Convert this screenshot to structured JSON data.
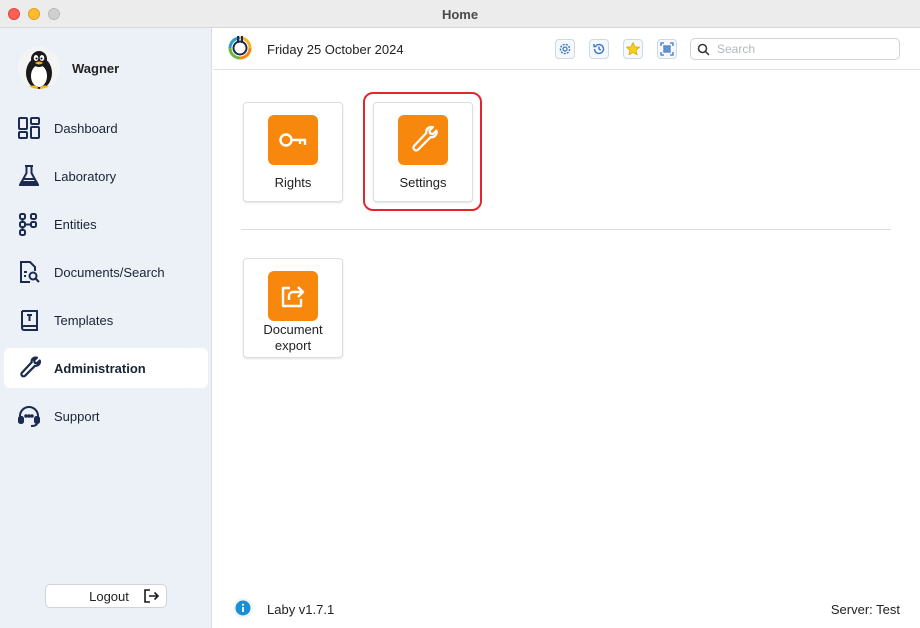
{
  "window": {
    "title": "Home"
  },
  "user": {
    "name": "Wagner"
  },
  "sidebar": {
    "items": [
      {
        "label": "Dashboard",
        "icon": "dashboard-icon",
        "active": false
      },
      {
        "label": "Laboratory",
        "icon": "flask-icon",
        "active": false
      },
      {
        "label": "Entities",
        "icon": "entities-icon",
        "active": false
      },
      {
        "label": "Documents/Search",
        "icon": "document-search-icon",
        "active": false
      },
      {
        "label": "Templates",
        "icon": "template-book-icon",
        "active": false
      },
      {
        "label": "Administration",
        "icon": "wrench-icon",
        "active": true
      },
      {
        "label": "Support",
        "icon": "headset-icon",
        "active": false
      }
    ],
    "logout_label": "Logout"
  },
  "header": {
    "date": "Friday 25 October 2024",
    "search_placeholder": "Search"
  },
  "tiles": [
    {
      "label": "Rights",
      "icon": "key-icon"
    },
    {
      "label": "Settings",
      "icon": "wrench-icon",
      "highlighted": true
    },
    {
      "label": "Document export",
      "icon": "export-icon"
    }
  ],
  "footer": {
    "version": "Laby v1.7.1",
    "server": "Server: Test"
  },
  "colors": {
    "accent": "#f7880d",
    "highlight": "#e3262b",
    "sidebar_bg": "#ecf1f8",
    "icon_navy": "#1b2a4e"
  }
}
